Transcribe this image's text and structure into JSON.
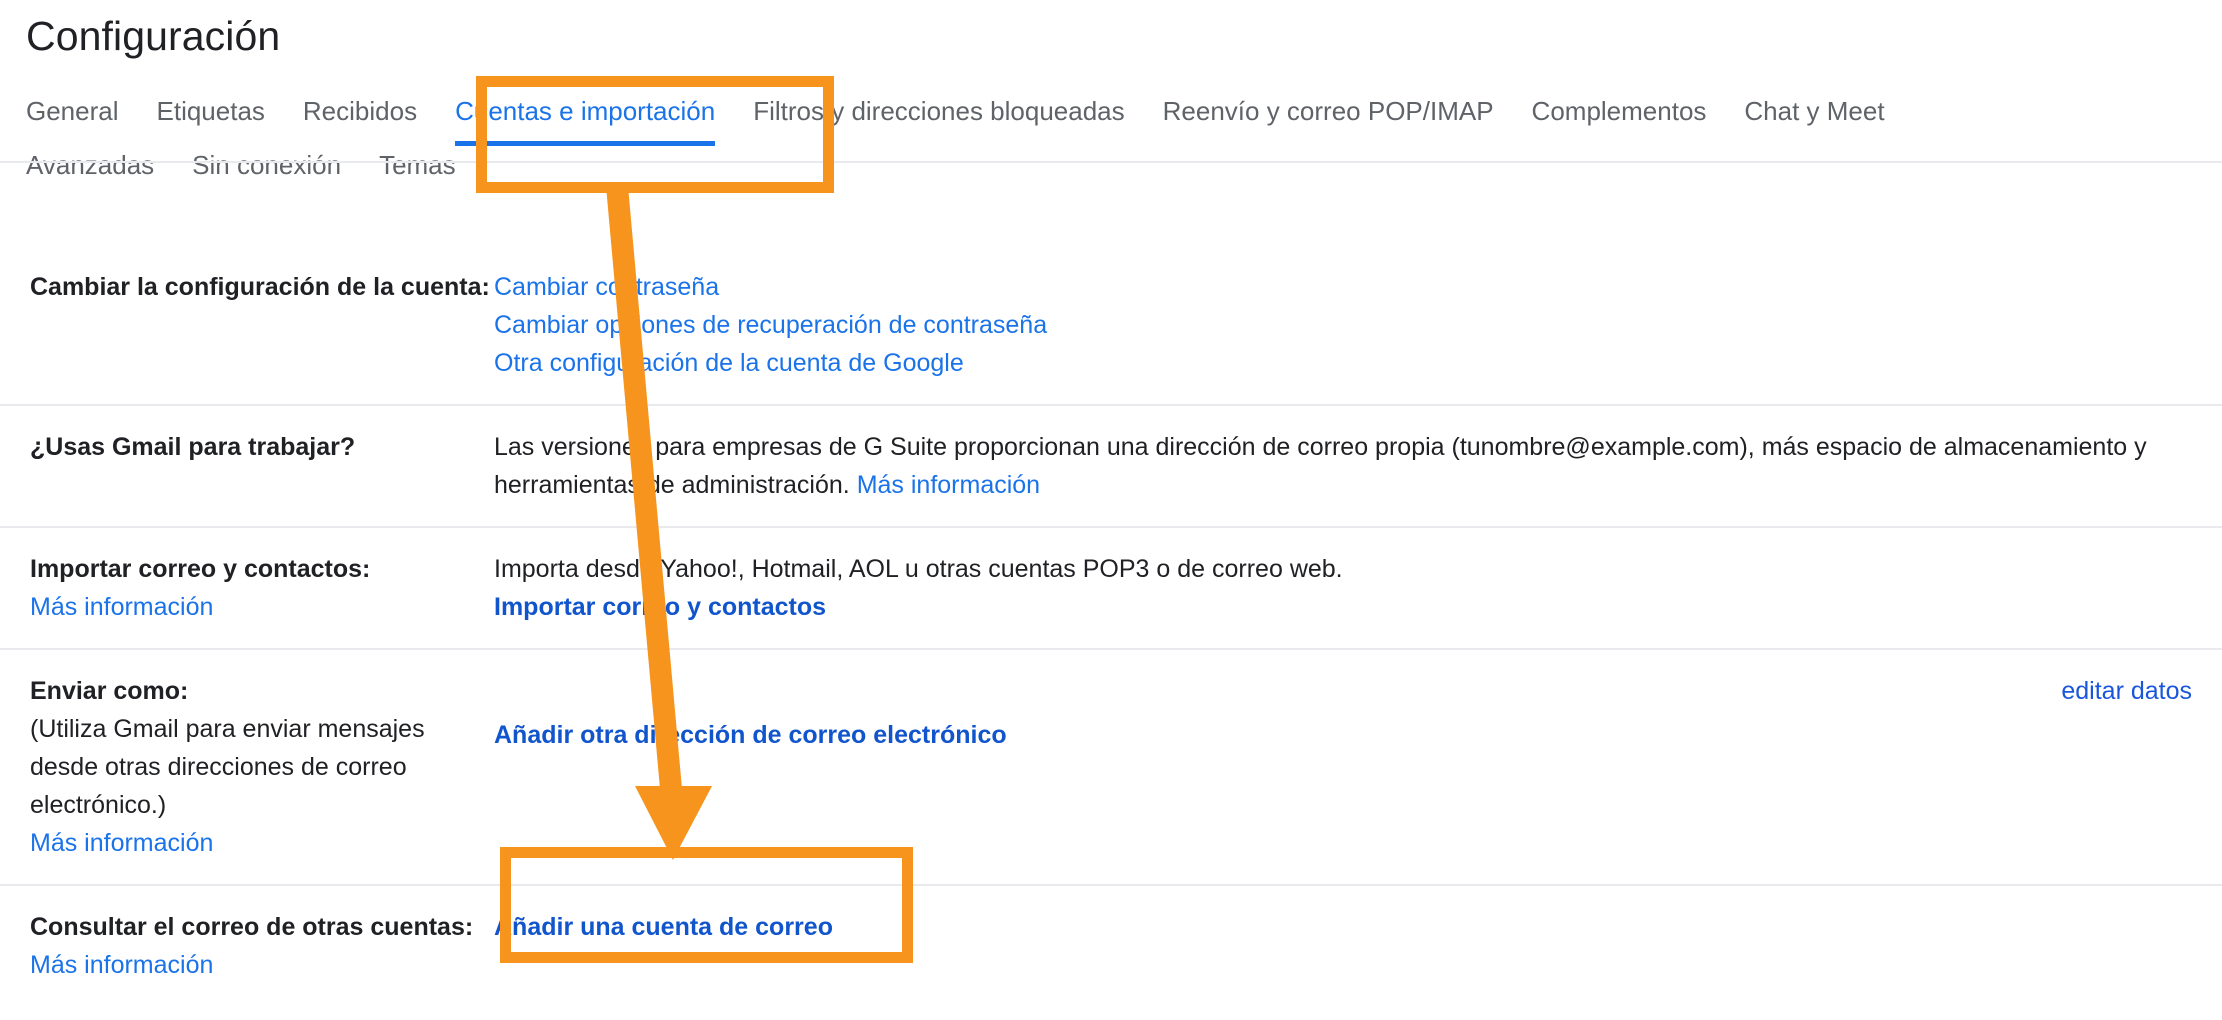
{
  "header": {
    "title": "Configuración"
  },
  "tabs": [
    {
      "label": "General",
      "active": false
    },
    {
      "label": "Etiquetas",
      "active": false
    },
    {
      "label": "Recibidos",
      "active": false
    },
    {
      "label": "Cuentas e importación",
      "active": true
    },
    {
      "label": "Filtros y direcciones bloqueadas",
      "active": false
    },
    {
      "label": "Reenvío y correo POP/IMAP",
      "active": false
    },
    {
      "label": "Complementos",
      "active": false
    },
    {
      "label": "Chat y Meet",
      "active": false
    },
    {
      "label": "Avanzadas",
      "active": false
    },
    {
      "label": "Sin conexión",
      "active": false
    },
    {
      "label": "Temas",
      "active": false
    }
  ],
  "rows": {
    "account_settings": {
      "label": "Cambiar la configuración de la cuenta:",
      "links": [
        "Cambiar contraseña",
        "Cambiar opciones de recuperación de contraseña",
        "Otra configuración de la cuenta de Google"
      ]
    },
    "gmail_work": {
      "label": "¿Usas Gmail para trabajar?",
      "text": "Las versiones para empresas de G Suite proporcionan una dirección de correo propia (tunombre@example.com), más espacio de almacenamiento y herramientas de administración.",
      "more_link": "Más información"
    },
    "import": {
      "label": "Importar correo y contactos:",
      "label_link": "Más información",
      "text": "Importa desde Yahoo!, Hotmail, AOL u otras cuentas POP3 o de correo web.",
      "action_link": "Importar correo y contactos"
    },
    "send_as": {
      "label": "Enviar como:",
      "note": "(Utiliza Gmail para enviar mensajes desde otras direcciones de correo electrónico.)",
      "label_link": "Más información",
      "value": "",
      "action_link": "Añadir otra dirección de correo electrónico",
      "edit_link": "editar datos"
    },
    "check_mail": {
      "label": "Consultar el correo de otras cuentas:",
      "label_link": "Más información",
      "action_link": "Añadir una cuenta de correo"
    }
  },
  "annotations": {
    "highlight_color": "#f7941d",
    "arrow": {
      "from_label": "Cuentas e importación",
      "to_label": "Añadir una cuenta de correo"
    }
  },
  "colors": {
    "link_blue": "#1a73e8",
    "bold_link_blue": "#1155cc",
    "text": "#202124",
    "tab_inactive": "#5f6368",
    "divider": "#e8eaed",
    "accent_orange": "#f7941d"
  }
}
